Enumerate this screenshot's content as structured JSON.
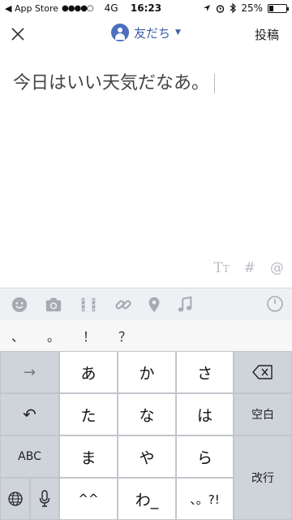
{
  "status_bar": {
    "back_app": "◀ App Store",
    "signal": "●●●●○",
    "network": "4G",
    "time": "16:23",
    "icons": [
      "location-icon",
      "alarm-icon",
      "bluetooth-icon"
    ],
    "battery_text": "25%",
    "battery_level": 0.25
  },
  "header": {
    "close_icon": "close-icon",
    "audience_label": "友だち",
    "audience_caret": "▼",
    "post_label": "投稿"
  },
  "compose": {
    "text": "今日はいい天気だなあ。"
  },
  "format_bar": {
    "text_style": "T",
    "text_style_small": "T",
    "hashtag": "#",
    "mention": "@"
  },
  "attach_bar": {
    "icons": [
      "emoji-icon",
      "camera-icon",
      "video-icon",
      "link-icon",
      "location-pin-icon",
      "music-icon"
    ],
    "timer_icon": "timer-icon"
  },
  "punctuation": [
    "、",
    "。",
    "！",
    "？"
  ],
  "keyboard": {
    "left_column": {
      "arrow": "→",
      "undo": "↶",
      "abc": "ABC",
      "globe": "globe-icon",
      "mic": "mic-icon"
    },
    "rows": [
      [
        "あ",
        "か",
        "さ"
      ],
      [
        "た",
        "な",
        "は"
      ],
      [
        "ま",
        "や",
        "ら"
      ],
      [
        "^^",
        "わ_",
        "、。?!"
      ]
    ],
    "right_column": {
      "delete": "delete-icon",
      "space": "空白",
      "enter": "改行"
    }
  },
  "colors": {
    "accent": "#3d5fa8",
    "avatar": "#4c6fbd",
    "toolbar_bg": "#eef0f3",
    "icon_gray": "#a6abb3"
  }
}
